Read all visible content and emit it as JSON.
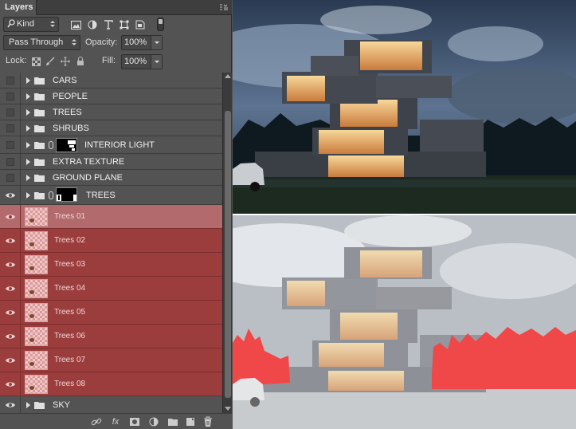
{
  "panel": {
    "tab_label": "Layers",
    "menu_icon": "panel-menu-icon",
    "filter": {
      "value": "Kind",
      "icon": "search-icon"
    },
    "blend_mode": "Pass Through",
    "opacity_label": "Opacity:",
    "opacity_value": "100%",
    "lock_label": "Lock:",
    "fill_label": "Fill:",
    "fill_value": "100%"
  },
  "layers": [
    {
      "name": "CARS",
      "type": "group",
      "visible": false
    },
    {
      "name": "PEOPLE",
      "type": "group",
      "visible": false
    },
    {
      "name": "TREES",
      "type": "group",
      "visible": false
    },
    {
      "name": "SHRUBS",
      "type": "group",
      "visible": false
    },
    {
      "name": "INTERIOR LIGHT",
      "type": "group-mask",
      "visible": false
    },
    {
      "name": "EXTRA TEXTURE",
      "type": "group",
      "visible": false
    },
    {
      "name": "GROUND PLANE",
      "type": "group",
      "visible": false
    },
    {
      "name": "TREES",
      "type": "group-mask",
      "visible": true
    },
    {
      "name": "Trees 01",
      "type": "layer",
      "visible": true,
      "selected": true
    },
    {
      "name": "Trees 02",
      "type": "layer",
      "visible": true
    },
    {
      "name": "Trees 03",
      "type": "layer",
      "visible": true
    },
    {
      "name": "Trees 04",
      "type": "layer",
      "visible": true
    },
    {
      "name": "Trees 05",
      "type": "layer",
      "visible": true
    },
    {
      "name": "Trees 06",
      "type": "layer",
      "visible": true
    },
    {
      "name": "Trees 07",
      "type": "layer",
      "visible": true
    },
    {
      "name": "Trees 08",
      "type": "layer",
      "visible": true
    },
    {
      "name": "SKY",
      "type": "group",
      "visible": true
    }
  ],
  "footer_icons": [
    "link-icon",
    "fx-icon",
    "mask-icon",
    "adjustment-icon",
    "folder-icon",
    "new-layer-icon",
    "trash-icon"
  ],
  "footer_fx_label": "fx",
  "colors": {
    "panel_bg": "#535353",
    "layer_red": "#9b3d3d",
    "layer_selected": "#b36a6d",
    "tree_mask": "#f04848"
  }
}
